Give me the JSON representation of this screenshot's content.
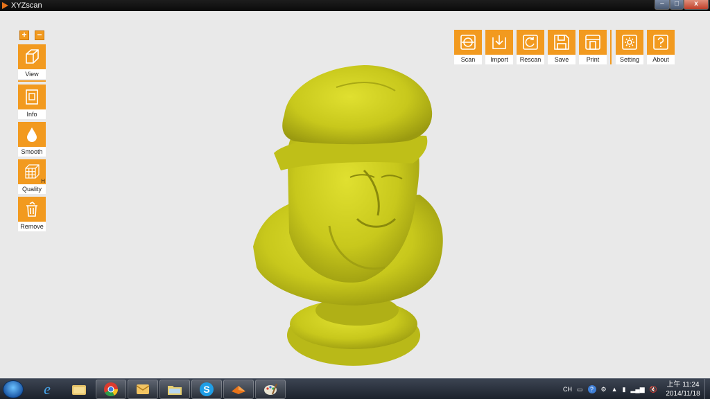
{
  "window": {
    "title": "XYZscan",
    "controls": {
      "minimize": "–",
      "maximize": "□",
      "close": "x"
    }
  },
  "zoom": {
    "in": "+",
    "out": "−"
  },
  "left_toolbar": [
    {
      "id": "view",
      "label": "View",
      "icon": "cube-icon"
    },
    {
      "id": "info",
      "label": "Info",
      "icon": "document-icon"
    },
    {
      "id": "smooth",
      "label": "Smooth",
      "icon": "droplet-icon"
    },
    {
      "id": "quality",
      "label": "Quality",
      "icon": "grid-cube-icon",
      "badge": "H"
    },
    {
      "id": "remove",
      "label": "Remove",
      "icon": "trash-icon"
    }
  ],
  "top_toolbar": [
    {
      "id": "scan",
      "label": "Scan",
      "icon": "scan-icon"
    },
    {
      "id": "import",
      "label": "Import",
      "icon": "import-icon"
    },
    {
      "id": "rescan",
      "label": "Rescan",
      "icon": "rescan-icon"
    },
    {
      "id": "save",
      "label": "Save",
      "icon": "save-icon"
    },
    {
      "id": "print",
      "label": "Print",
      "icon": "print-icon"
    },
    {
      "id": "setting",
      "label": "Setting",
      "icon": "gear-icon"
    },
    {
      "id": "about",
      "label": "About",
      "icon": "question-icon"
    }
  ],
  "colors": {
    "accent": "#f29a1f",
    "model": "#c8c81c",
    "background": "#e9e9e9"
  },
  "taskbar": {
    "apps": [
      "ie-icon",
      "explorer-icon",
      "chrome-icon",
      "mail-icon",
      "folder-icon",
      "skype-icon",
      "xyzscan-icon",
      "paint-icon"
    ],
    "tray": {
      "language": "CH"
    },
    "clock": {
      "time": "上午 11:24",
      "date": "2014/11/18"
    }
  }
}
